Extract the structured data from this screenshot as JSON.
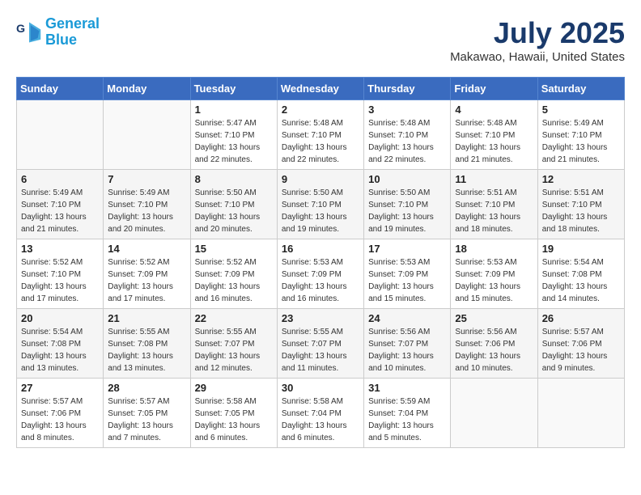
{
  "header": {
    "logo_line1": "General",
    "logo_line2": "Blue",
    "month": "July 2025",
    "location": "Makawao, Hawaii, United States"
  },
  "weekdays": [
    "Sunday",
    "Monday",
    "Tuesday",
    "Wednesday",
    "Thursday",
    "Friday",
    "Saturday"
  ],
  "weeks": [
    [
      {
        "day": "",
        "info": ""
      },
      {
        "day": "",
        "info": ""
      },
      {
        "day": "1",
        "info": "Sunrise: 5:47 AM\nSunset: 7:10 PM\nDaylight: 13 hours\nand 22 minutes."
      },
      {
        "day": "2",
        "info": "Sunrise: 5:48 AM\nSunset: 7:10 PM\nDaylight: 13 hours\nand 22 minutes."
      },
      {
        "day": "3",
        "info": "Sunrise: 5:48 AM\nSunset: 7:10 PM\nDaylight: 13 hours\nand 22 minutes."
      },
      {
        "day": "4",
        "info": "Sunrise: 5:48 AM\nSunset: 7:10 PM\nDaylight: 13 hours\nand 21 minutes."
      },
      {
        "day": "5",
        "info": "Sunrise: 5:49 AM\nSunset: 7:10 PM\nDaylight: 13 hours\nand 21 minutes."
      }
    ],
    [
      {
        "day": "6",
        "info": "Sunrise: 5:49 AM\nSunset: 7:10 PM\nDaylight: 13 hours\nand 21 minutes."
      },
      {
        "day": "7",
        "info": "Sunrise: 5:49 AM\nSunset: 7:10 PM\nDaylight: 13 hours\nand 20 minutes."
      },
      {
        "day": "8",
        "info": "Sunrise: 5:50 AM\nSunset: 7:10 PM\nDaylight: 13 hours\nand 20 minutes."
      },
      {
        "day": "9",
        "info": "Sunrise: 5:50 AM\nSunset: 7:10 PM\nDaylight: 13 hours\nand 19 minutes."
      },
      {
        "day": "10",
        "info": "Sunrise: 5:50 AM\nSunset: 7:10 PM\nDaylight: 13 hours\nand 19 minutes."
      },
      {
        "day": "11",
        "info": "Sunrise: 5:51 AM\nSunset: 7:10 PM\nDaylight: 13 hours\nand 18 minutes."
      },
      {
        "day": "12",
        "info": "Sunrise: 5:51 AM\nSunset: 7:10 PM\nDaylight: 13 hours\nand 18 minutes."
      }
    ],
    [
      {
        "day": "13",
        "info": "Sunrise: 5:52 AM\nSunset: 7:10 PM\nDaylight: 13 hours\nand 17 minutes."
      },
      {
        "day": "14",
        "info": "Sunrise: 5:52 AM\nSunset: 7:09 PM\nDaylight: 13 hours\nand 17 minutes."
      },
      {
        "day": "15",
        "info": "Sunrise: 5:52 AM\nSunset: 7:09 PM\nDaylight: 13 hours\nand 16 minutes."
      },
      {
        "day": "16",
        "info": "Sunrise: 5:53 AM\nSunset: 7:09 PM\nDaylight: 13 hours\nand 16 minutes."
      },
      {
        "day": "17",
        "info": "Sunrise: 5:53 AM\nSunset: 7:09 PM\nDaylight: 13 hours\nand 15 minutes."
      },
      {
        "day": "18",
        "info": "Sunrise: 5:53 AM\nSunset: 7:09 PM\nDaylight: 13 hours\nand 15 minutes."
      },
      {
        "day": "19",
        "info": "Sunrise: 5:54 AM\nSunset: 7:08 PM\nDaylight: 13 hours\nand 14 minutes."
      }
    ],
    [
      {
        "day": "20",
        "info": "Sunrise: 5:54 AM\nSunset: 7:08 PM\nDaylight: 13 hours\nand 13 minutes."
      },
      {
        "day": "21",
        "info": "Sunrise: 5:55 AM\nSunset: 7:08 PM\nDaylight: 13 hours\nand 13 minutes."
      },
      {
        "day": "22",
        "info": "Sunrise: 5:55 AM\nSunset: 7:07 PM\nDaylight: 13 hours\nand 12 minutes."
      },
      {
        "day": "23",
        "info": "Sunrise: 5:55 AM\nSunset: 7:07 PM\nDaylight: 13 hours\nand 11 minutes."
      },
      {
        "day": "24",
        "info": "Sunrise: 5:56 AM\nSunset: 7:07 PM\nDaylight: 13 hours\nand 10 minutes."
      },
      {
        "day": "25",
        "info": "Sunrise: 5:56 AM\nSunset: 7:06 PM\nDaylight: 13 hours\nand 10 minutes."
      },
      {
        "day": "26",
        "info": "Sunrise: 5:57 AM\nSunset: 7:06 PM\nDaylight: 13 hours\nand 9 minutes."
      }
    ],
    [
      {
        "day": "27",
        "info": "Sunrise: 5:57 AM\nSunset: 7:06 PM\nDaylight: 13 hours\nand 8 minutes."
      },
      {
        "day": "28",
        "info": "Sunrise: 5:57 AM\nSunset: 7:05 PM\nDaylight: 13 hours\nand 7 minutes."
      },
      {
        "day": "29",
        "info": "Sunrise: 5:58 AM\nSunset: 7:05 PM\nDaylight: 13 hours\nand 6 minutes."
      },
      {
        "day": "30",
        "info": "Sunrise: 5:58 AM\nSunset: 7:04 PM\nDaylight: 13 hours\nand 6 minutes."
      },
      {
        "day": "31",
        "info": "Sunrise: 5:59 AM\nSunset: 7:04 PM\nDaylight: 13 hours\nand 5 minutes."
      },
      {
        "day": "",
        "info": ""
      },
      {
        "day": "",
        "info": ""
      }
    ]
  ]
}
